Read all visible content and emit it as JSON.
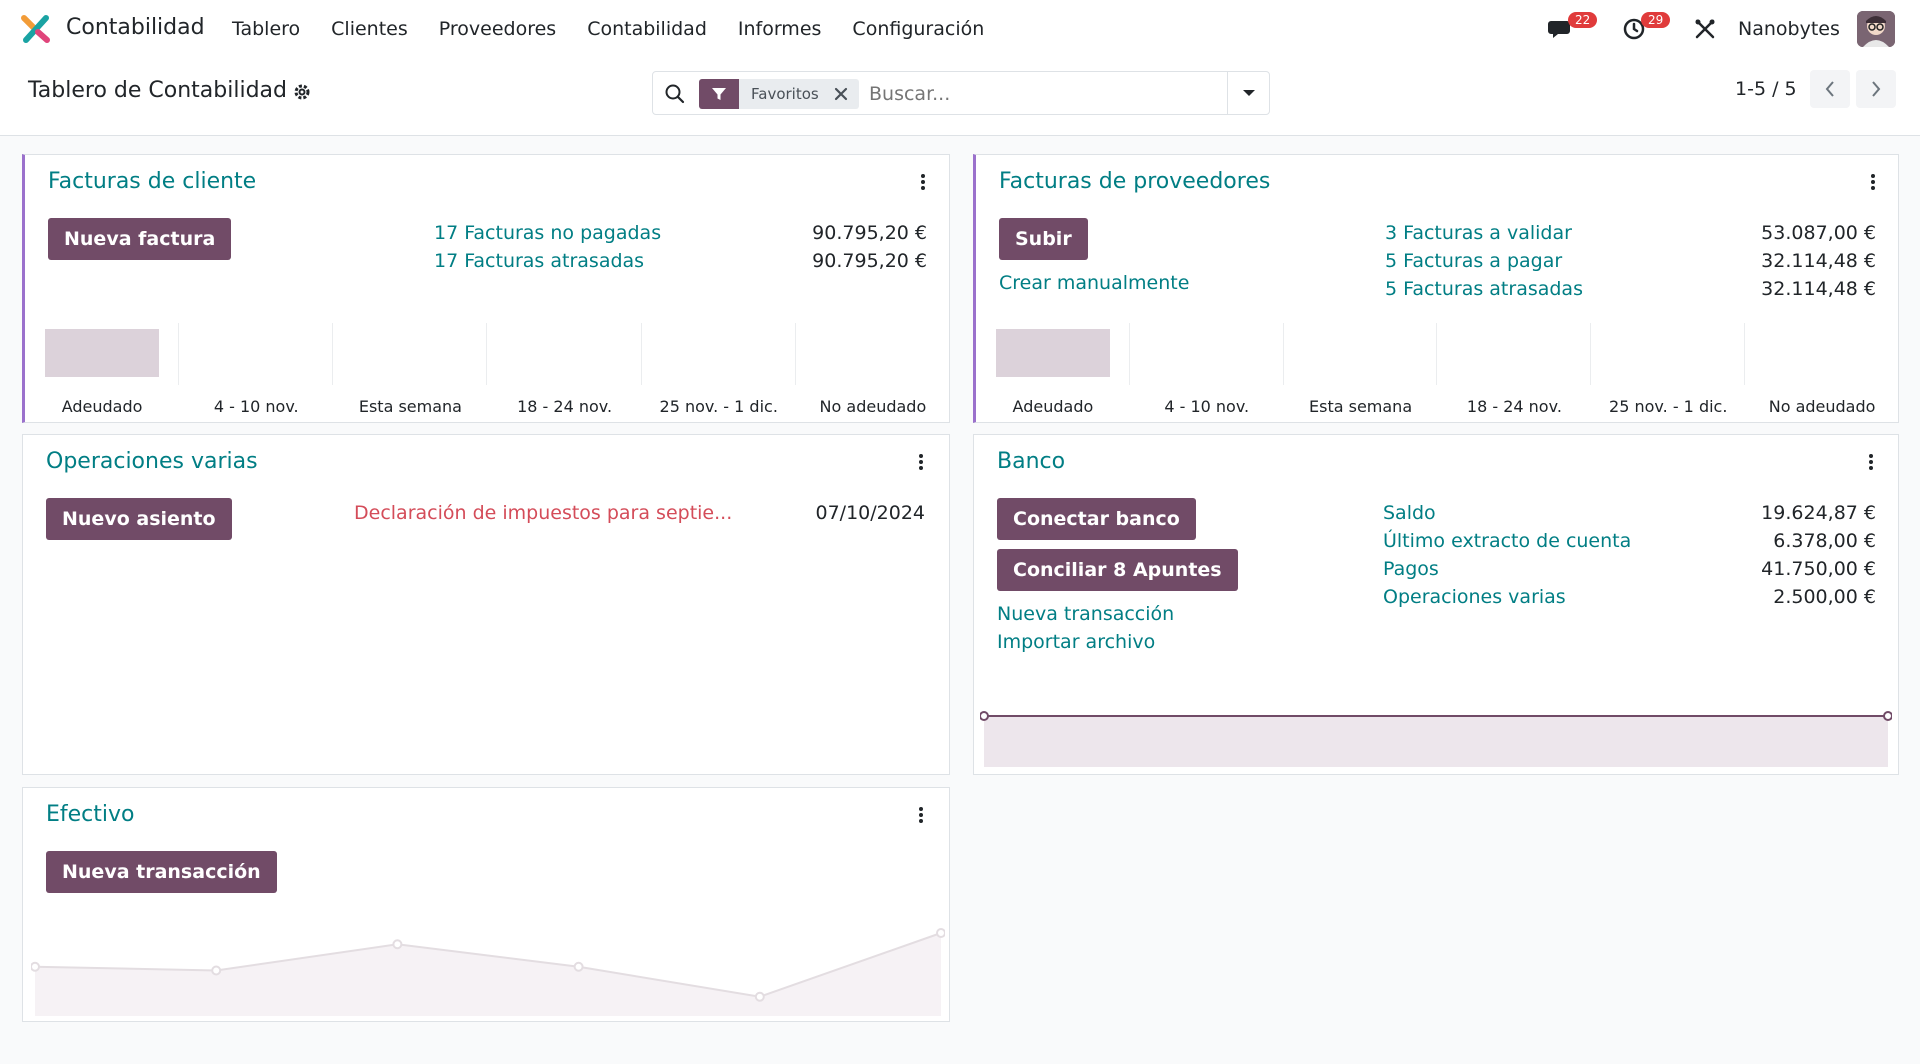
{
  "navbar": {
    "app_name": "Contabilidad",
    "menu": [
      "Tablero",
      "Clientes",
      "Proveedores",
      "Contabilidad",
      "Informes",
      "Configuración"
    ],
    "messages_count": "22",
    "activities_count": "29",
    "company": "Nanobytes"
  },
  "control_panel": {
    "breadcrumb": "Tablero de Contabilidad",
    "facet_label": "Favoritos",
    "search_placeholder": "Buscar...",
    "pager": "1-5 / 5"
  },
  "colors": {
    "primary": "#714b67",
    "link": "#017e84",
    "danger": "#d44c59",
    "accent_border": "#9b71cc",
    "bar_fill": "#dcd2da"
  },
  "cards": {
    "customer_invoices": {
      "title": "Facturas de cliente",
      "button": "Nueva factura",
      "stats": [
        {
          "label": "17 Facturas no pagadas",
          "amount": "90.795,20 €"
        },
        {
          "label": "17 Facturas atrasadas",
          "amount": "90.795,20 €"
        }
      ],
      "graph": {
        "categories": [
          "Adeudado",
          "4 - 10 nov.",
          "Esta semana",
          "18 - 24 nov.",
          "25 nov. - 1 dic.",
          "No adeudado"
        ],
        "values": [
          90795.2,
          0,
          0,
          0,
          0,
          0
        ]
      }
    },
    "vendor_bills": {
      "title": "Facturas de proveedores",
      "button": "Subir",
      "secondary_link": "Crear manualmente",
      "stats": [
        {
          "label": "3 Facturas a validar",
          "amount": "53.087,00 €"
        },
        {
          "label": "5 Facturas a pagar",
          "amount": "32.114,48 €"
        },
        {
          "label": "5 Facturas atrasadas",
          "amount": "32.114,48 €"
        }
      ],
      "graph": {
        "categories": [
          "Adeudado",
          "4 - 10 nov.",
          "Esta semana",
          "18 - 24 nov.",
          "25 nov. - 1 dic.",
          "No adeudado"
        ],
        "values": [
          32114.48,
          0,
          0,
          0,
          0,
          0
        ]
      }
    },
    "misc_operations": {
      "title": "Operaciones varias",
      "button": "Nuevo asiento",
      "entry_label": "Declaración de impuestos para septie...",
      "entry_date": "07/10/2024"
    },
    "bank": {
      "title": "Banco",
      "button_connect": "Conectar banco",
      "button_reconcile": "Conciliar 8 Apuntes",
      "links": [
        "Nueva transacción",
        "Importar archivo"
      ],
      "stats": [
        {
          "label": "Saldo",
          "amount": "19.624,87 €"
        },
        {
          "label": "Último extracto de cuenta",
          "amount": "6.378,00 €"
        },
        {
          "label": "Pagos",
          "amount": "41.750,00 €"
        },
        {
          "label": "Operaciones varias",
          "amount": "2.500,00 €"
        }
      ],
      "graph_values": [
        1,
        1
      ]
    },
    "cash": {
      "title": "Efectivo",
      "button": "Nueva transacción",
      "graph_values": [
        0.55,
        0.5,
        0.85,
        0.55,
        0.15,
        1.0
      ]
    }
  }
}
